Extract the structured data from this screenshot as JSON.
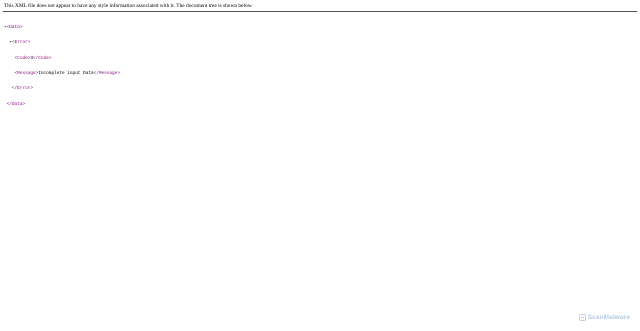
{
  "notice": {
    "text": "This XML file does not appear to have any style information associated with it. The document tree is shown below."
  },
  "tree": {
    "toggle": "▾",
    "data_open": "<Data>",
    "error_open": "<Error>",
    "code_open": "<Code>",
    "code_value": "3",
    "code_close": "</Code>",
    "message_open": "<Message>",
    "message_value": "Incomplete input Data",
    "message_close": "</Message>",
    "error_close": "</Error>",
    "data_close": "</Data>"
  },
  "watermark": {
    "text": "ScanMalware",
    "icon": "scanmalware-logo-icon",
    "color": "#7aa0c8"
  },
  "colors": {
    "tag": "#881280",
    "text": "#000000",
    "rule": "#555555"
  }
}
